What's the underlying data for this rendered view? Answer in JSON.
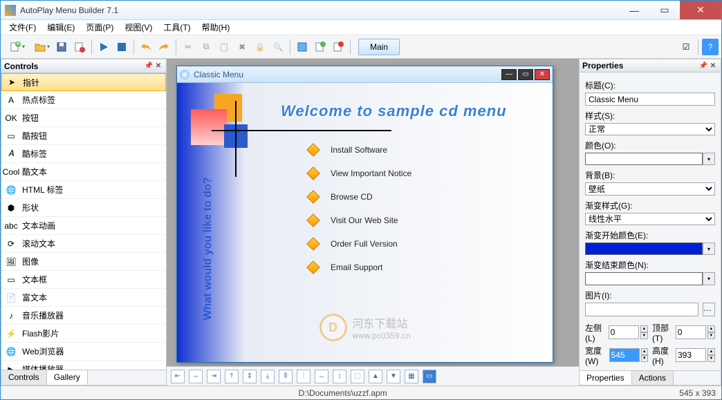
{
  "window": {
    "title": "AutoPlay Menu Builder 7.1"
  },
  "menubar": [
    "文件(F)",
    "编辑(E)",
    "页面(P)",
    "视图(V)",
    "工具(T)",
    "帮助(H)"
  ],
  "toolbar": {
    "main_tab": "Main"
  },
  "controls_panel": {
    "title": "Controls",
    "items": [
      {
        "icon": "pointer",
        "label": "指针",
        "selected": true
      },
      {
        "icon": "hotlabel",
        "label": "热点标签"
      },
      {
        "icon": "button",
        "label": "按钮"
      },
      {
        "icon": "coolbutton",
        "label": "酷按钮"
      },
      {
        "icon": "coollabel",
        "label": "酷标签"
      },
      {
        "icon": "cooltext",
        "label": "酷文本"
      },
      {
        "icon": "html",
        "label": "HTML 标签"
      },
      {
        "icon": "shape",
        "label": "形状"
      },
      {
        "icon": "textanim",
        "label": "文本动画"
      },
      {
        "icon": "scrolltext",
        "label": "滚动文本"
      },
      {
        "icon": "image",
        "label": "图像"
      },
      {
        "icon": "textbox",
        "label": "文本框"
      },
      {
        "icon": "richtext",
        "label": "富文本"
      },
      {
        "icon": "music",
        "label": "音乐播放器"
      },
      {
        "icon": "flash",
        "label": "Flash影片"
      },
      {
        "icon": "web",
        "label": "Web浏览器"
      },
      {
        "icon": "media",
        "label": "媒体播放器"
      }
    ],
    "tabs": [
      "Controls",
      "Gallery"
    ],
    "active_tab": 1
  },
  "canvas_window": {
    "title": "Classic Menu",
    "welcome": "Welcome to sample cd menu",
    "side_text": "What would you like to do?",
    "menu_items": [
      "Install Software",
      "View Important Notice",
      "Browse CD",
      "Visit Our Web Site",
      "Order Full Version",
      "Email Support"
    ]
  },
  "properties_panel": {
    "title": "Properties",
    "labels": {
      "caption": "标题(C):",
      "style": "样式(S):",
      "color": "颜色(O):",
      "background": "背景(B):",
      "gradient_style": "渐变样式(G):",
      "gradient_start": "渐变开始颜色(E):",
      "gradient_end": "渐变结束颜色(N):",
      "picture": "图片(I):",
      "left": "左侧(L)",
      "top": "顶部(T)",
      "width": "宽度(W)",
      "height": "高度(H)"
    },
    "values": {
      "caption": "Classic Menu",
      "style": "正常",
      "color_swatch": "#ffffff",
      "background": "壁纸",
      "gradient_style": "线性水平",
      "gradient_start_swatch": "#0020d8",
      "gradient_end_swatch": "#ffffff",
      "picture": "",
      "left": "0",
      "top": "0",
      "width": "545",
      "height": "393"
    },
    "tabs": [
      "Properties",
      "Actions"
    ],
    "active_tab": 0
  },
  "statusbar": {
    "path": "D:\\Documents\\uzzf.apm",
    "dims": "545 x 393"
  },
  "watermark": {
    "text": "河东下载站",
    "url": "www.pc0359.cn"
  }
}
